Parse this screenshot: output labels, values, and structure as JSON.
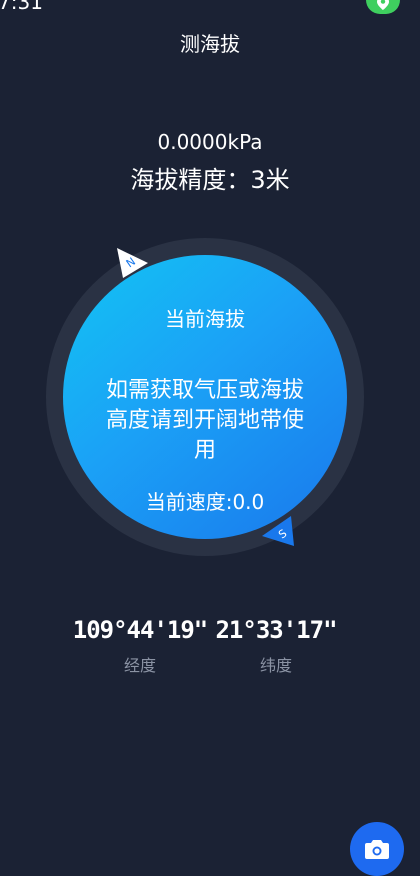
{
  "status_bar": {
    "time": "7:31",
    "location_icon": "location-pin-icon",
    "location_color": "#3fcf5f"
  },
  "header": {
    "title": "测海拔"
  },
  "readings": {
    "pressure": "0.0000kPa",
    "accuracy": "海拔精度：3米"
  },
  "dial": {
    "title": "当前海拔",
    "message": "如需获取气压或海拔高度请到开阔地带使用",
    "speed": "当前速度:0.0",
    "north_marker": "N",
    "south_marker": "S",
    "ring_color": "#2a3244",
    "gradient_start": "#12c4f3",
    "gradient_end": "#1978ec"
  },
  "coordinates": {
    "longitude_value": "109°44'19\"",
    "longitude_label": "经度",
    "latitude_value": "21°33'17\"",
    "latitude_label": "纬度"
  },
  "camera": {
    "icon": "camera-icon",
    "color": "#1e6af0"
  },
  "colors": {
    "background": "#1b2234",
    "muted_text": "#8b93a4"
  }
}
